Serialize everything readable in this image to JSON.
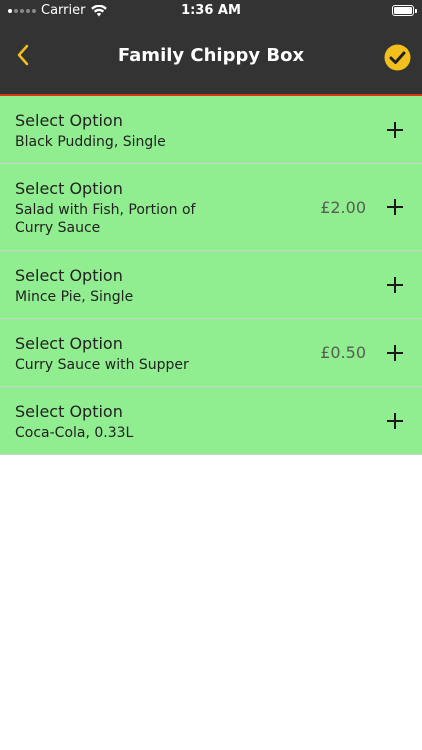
{
  "status_bar": {
    "carrier": "Carrier",
    "time": "1:36 AM"
  },
  "nav": {
    "title": "Family Chippy Box",
    "back_icon": "chevron-left-icon",
    "confirm_icon": "checkmark-circle-icon",
    "accent_color": "#f2c01e"
  },
  "colors": {
    "header_bg": "#333333",
    "header_border": "#d63a14",
    "row_bg": "#90ee90"
  },
  "options": [
    {
      "title": "Select Option",
      "selection": "Black Pudding, Single",
      "price": ""
    },
    {
      "title": "Select Option",
      "selection": "Salad with Fish, Portion of Curry Sauce",
      "price": "£2.00"
    },
    {
      "title": "Select Option",
      "selection": "Mince Pie, Single",
      "price": ""
    },
    {
      "title": "Select Option",
      "selection": "Curry Sauce with Supper",
      "price": "£0.50"
    },
    {
      "title": "Select Option",
      "selection": "Coca-Cola, 0.33L",
      "price": ""
    }
  ]
}
